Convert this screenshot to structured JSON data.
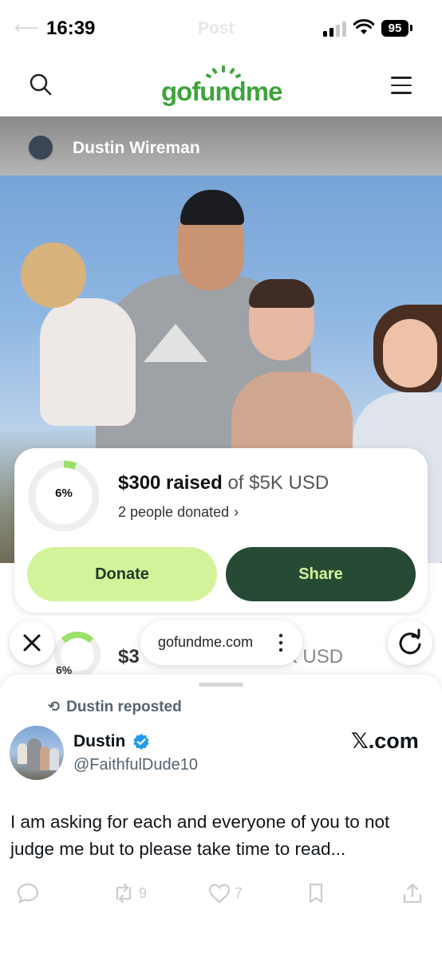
{
  "status_bar": {
    "time": "16:39",
    "background_title": "Post",
    "battery": "95",
    "icons": [
      "signal-icon",
      "wifi-icon",
      "battery-icon"
    ]
  },
  "gofundme_header": {
    "logo_text": "gofundme",
    "brand_color": "#3fa33c",
    "icons": [
      "search-icon",
      "menu-icon"
    ]
  },
  "campaign": {
    "organizer_name": "Dustin Wireman",
    "progress_fraction": 0.06,
    "progress_label": "6%",
    "raised_amount": "$300 raised",
    "raised_goal": "of $5K USD",
    "donors": "2 people donated",
    "donate_label": "Donate",
    "share_label": "Share",
    "colors": {
      "donate_bg": "#d3f39b",
      "share_bg": "#264a33",
      "progress": "#9be06a"
    }
  },
  "browser_bar": {
    "url": "gofundme.com",
    "ghost_pct": "6%",
    "ghost_amount": "$3",
    "ghost_goal": "5K USD",
    "icons": [
      "close-icon",
      "more-icon",
      "reload-icon"
    ]
  },
  "x_post": {
    "repost_text": "Dustin reposted",
    "author_name": "Dustin",
    "author_handle": "@FaithfulDude10",
    "site": "𝕏.com",
    "text": "I am asking for each and everyone of you to not judge me but to please take time to read...",
    "retweets": "9",
    "likes": "7",
    "icons": [
      "reply-icon",
      "retweet-icon",
      "like-icon",
      "bookmark-icon",
      "share-icon",
      "verified-icon"
    ]
  }
}
